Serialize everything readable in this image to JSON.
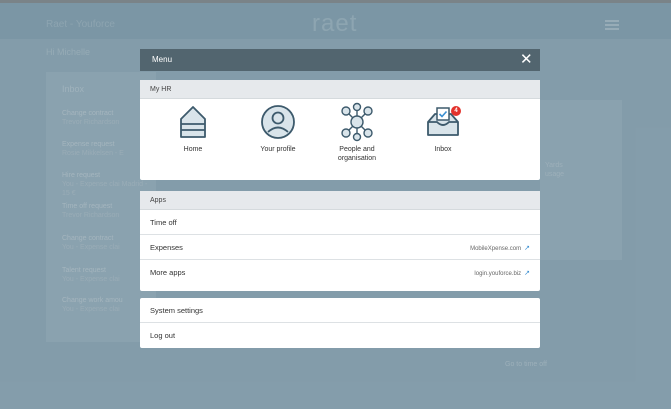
{
  "app": {
    "name": "Raet - Youforce",
    "logo": "raet",
    "greeting": "Hi Michelle"
  },
  "background": {
    "inbox": {
      "title": "Inbox",
      "items": [
        {
          "title": "Change contract",
          "sub": "Trevor Richardson"
        },
        {
          "title": "Expense request",
          "sub": "Rosie Mikkelsen - E"
        },
        {
          "title": "Hire request",
          "sub": "You - Expense clai Madrid - 15 € "
        },
        {
          "title": "Time off request",
          "sub": "Trevor Richardson"
        },
        {
          "title": "Change contract",
          "sub": "You - Expense clai"
        },
        {
          "title": "Talent request",
          "sub": "You - Expense clai"
        },
        {
          "title": "Change work amou",
          "sub": "You - Expense clai"
        }
      ]
    },
    "right": {
      "texts": [
        "Yards",
        "usage",
        "Go to time off"
      ]
    }
  },
  "menu": {
    "title": "Menu",
    "close_icon": "✕",
    "myhr": {
      "header": "My HR",
      "tiles": [
        {
          "label": "Home",
          "icon": "home-icon"
        },
        {
          "label": "Your profile",
          "icon": "profile-icon"
        },
        {
          "label": "People and organisation",
          "icon": "people-org-icon"
        },
        {
          "label": "Inbox",
          "icon": "inbox-icon",
          "badge": "4"
        }
      ]
    },
    "apps": {
      "header": "Apps",
      "items": [
        {
          "label": "Time off",
          "link": ""
        },
        {
          "label": "Expenses",
          "link": "MobileXpense.com"
        },
        {
          "label": "More apps",
          "link": "login.youforce.biz"
        }
      ]
    },
    "system": {
      "items": [
        {
          "label": "System settings"
        },
        {
          "label": "Log out"
        }
      ]
    }
  },
  "colors": {
    "menu_bar": "#52656f",
    "badge": "#e3322c",
    "link_icon": "#3b8fd1",
    "icon_stroke": "#3d5a6c",
    "icon_fill": "#d9e4ea"
  }
}
